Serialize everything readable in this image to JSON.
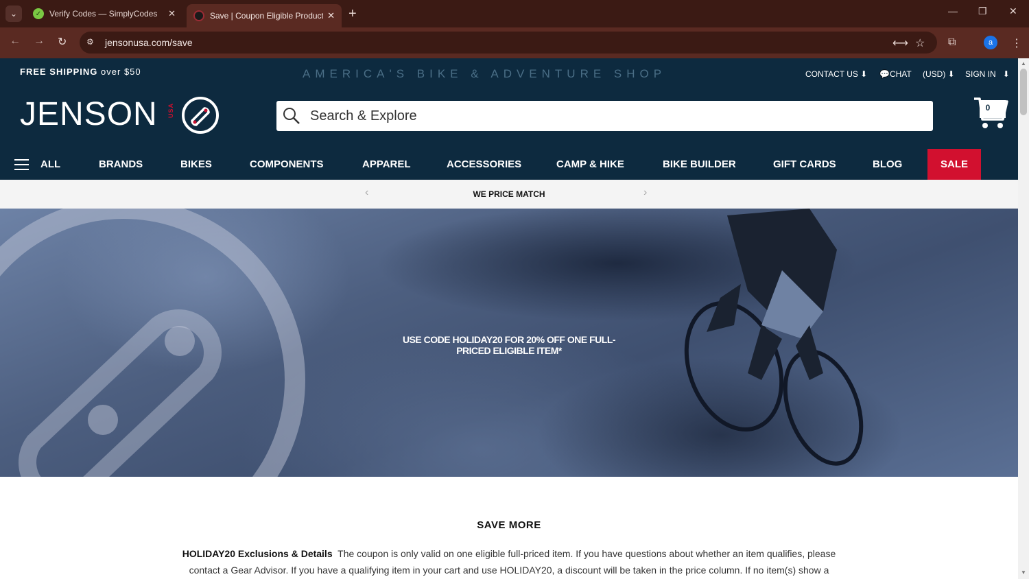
{
  "browser": {
    "tabs": [
      {
        "title": "Verify Codes — SimplyCodes",
        "active": false
      },
      {
        "title": "Save | Coupon Eligible Products",
        "active": true
      }
    ],
    "url": "jensonusa.com/save",
    "profile_initial": "a"
  },
  "header": {
    "free_shipping_bold": "FREE SHIPPING",
    "free_shipping_rest": "over $50",
    "tagline": "AMERICA'S BIKE & ADVENTURE SHOP",
    "contact": "CONTACT US",
    "chat": "CHAT",
    "currency": "(USD)",
    "sign_in": "SIGN IN",
    "logo": "JENSON",
    "logo_usa": "USA",
    "cart_count": "0"
  },
  "search": {
    "placeholder": "Search & Explore"
  },
  "nav": {
    "all": "ALL",
    "brands": "BRANDS",
    "bikes": "BIKES",
    "components": "COMPONENTS",
    "apparel": "APPAREL",
    "accessories": "ACCESSORIES",
    "camp_hike": "CAMP & HIKE",
    "bike_builder": "BIKE BUILDER",
    "gift_cards": "GIFT CARDS",
    "blog": "BLOG",
    "sale": "SALE"
  },
  "promo": {
    "text": "WE PRICE MATCH"
  },
  "hero": {
    "text": "USE CODE HOLIDAY20 FOR 20% OFF ONE FULL-PRICED ELIGIBLE ITEM*"
  },
  "content": {
    "heading": "SAVE MORE",
    "details_title": "HOLIDAY20 Exclusions & Details",
    "details_body": "The coupon is only valid on one eligible full-priced item. If you have questions about whether an item qualifies, please contact a Gear Advisor. If you have a qualifying item in your cart and use HOLIDAY20, a discount will be taken in the price column. If no item(s) show a"
  },
  "colors": {
    "header_bg": "#0d2a3f",
    "sale_bg": "#d2102f",
    "brand_red": "#c8102e"
  }
}
